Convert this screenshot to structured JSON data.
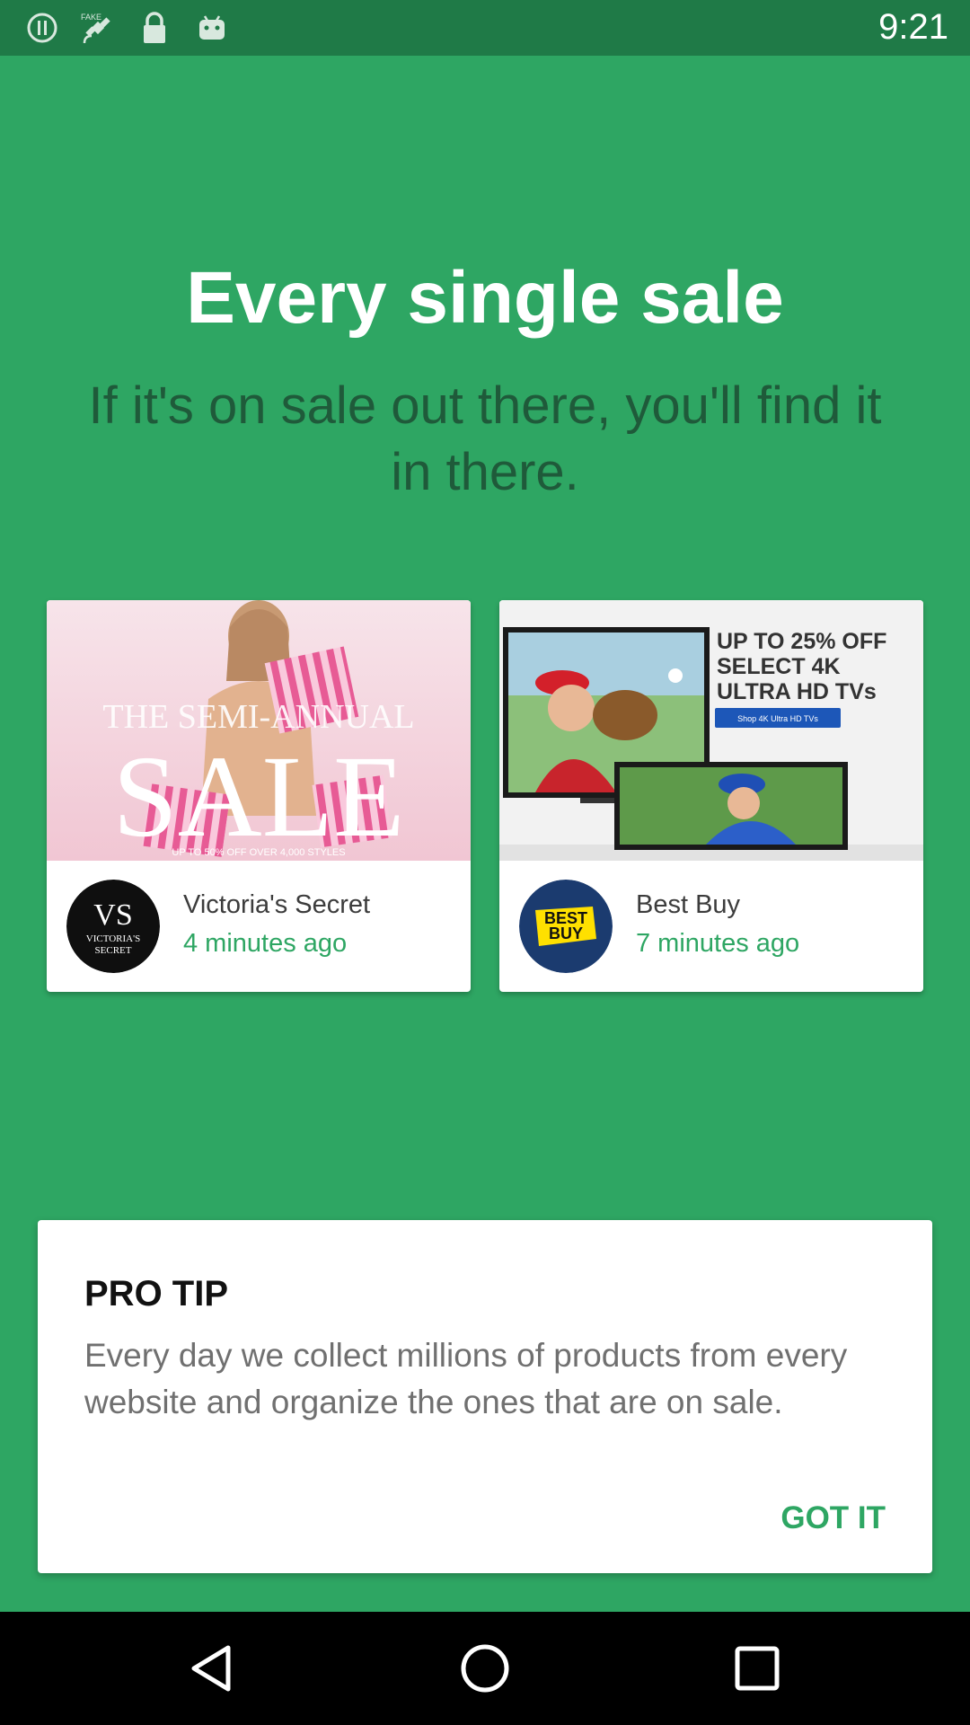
{
  "status_bar": {
    "time": "9:21",
    "icons": [
      "sync-off-icon",
      "satellite-icon",
      "lock-icon",
      "android-icon"
    ]
  },
  "hero": {
    "title": "Every single sale",
    "subtitle": "If it's on sale out there, you'll find it in there."
  },
  "deals": [
    {
      "store": "Victoria's Secret",
      "time": "4 minutes ago",
      "banner_text": [
        "THE SEMI-ANNUAL",
        "SALE",
        "UP TO 50% OFF OVER 4,000 STYLES"
      ],
      "logo_text": [
        "VICTORIA'S",
        "SECRET"
      ],
      "logo_monogram": "VS"
    },
    {
      "store": "Best Buy",
      "time": "7 minutes ago",
      "banner_text": [
        "UP TO 25% OFF",
        "SELECT 4K",
        "ULTRA HD TVs"
      ],
      "banner_button": "Shop 4K Ultra HD TVs",
      "logo_text": [
        "BEST",
        "BUY"
      ]
    }
  ],
  "pro_tip": {
    "title": "PRO TIP",
    "body": "Every day we collect millions of products from every website and organize the ones that are on sale.",
    "action": "GOT IT"
  },
  "nav": [
    "back-icon",
    "home-icon",
    "recents-icon"
  ],
  "colors": {
    "primary_green": "#2ea663",
    "status_bar_green": "#1f7a47",
    "subtitle_dark_green": "#1f5a3a",
    "best_buy_navy": "#1b3b6f",
    "best_buy_yellow": "#ffe000",
    "vs_pink": "#e75b95"
  }
}
